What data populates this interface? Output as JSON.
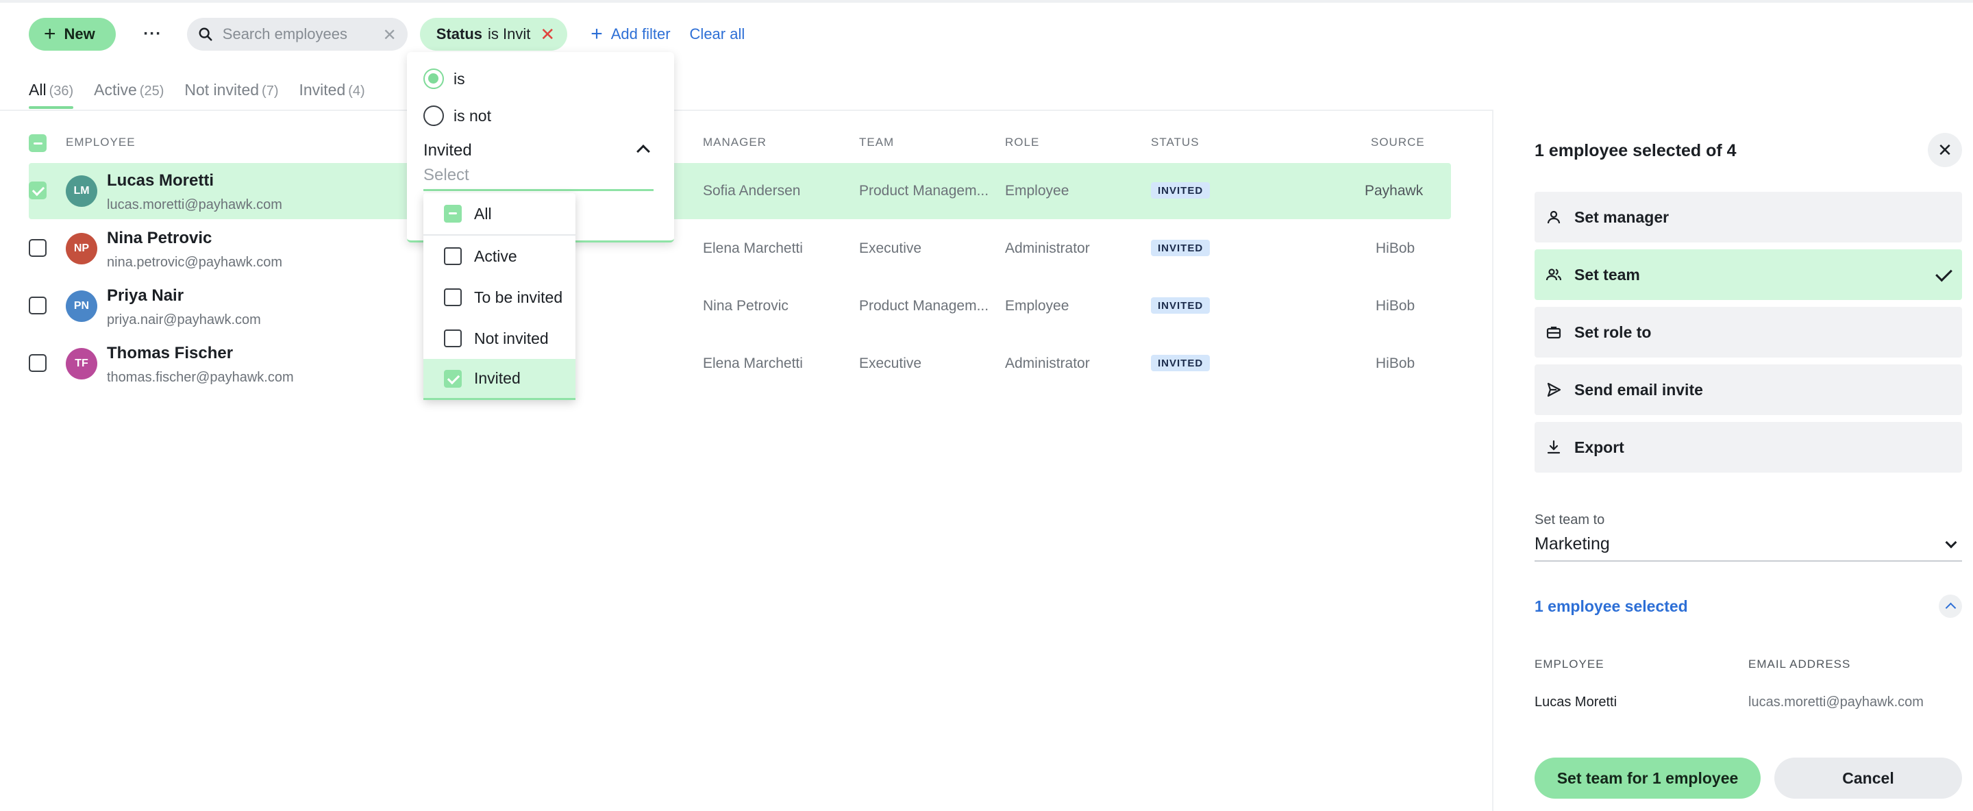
{
  "toolbar": {
    "new_label": "New",
    "search_placeholder": "Search employees",
    "filter_chip": {
      "field": "Status",
      "text": "is Invit"
    },
    "add_filter_label": "Add filter",
    "clear_all_label": "Clear all"
  },
  "tabs": [
    {
      "label": "All",
      "count": "(36)",
      "active": true
    },
    {
      "label": "Active",
      "count": "(25)"
    },
    {
      "label": "Not invited",
      "count": "(7)"
    },
    {
      "label": "Invited",
      "count": "(4)"
    }
  ],
  "table": {
    "headers": {
      "employee": "EMPLOYEE",
      "manager": "MANAGER",
      "team": "TEAM",
      "role": "ROLE",
      "status": "STATUS",
      "source": "SOURCE"
    },
    "rows": [
      {
        "initials": "LM",
        "avatar_color": "#4f9a8f",
        "name": "Lucas Moretti",
        "email": "lucas.moretti@payhawk.com",
        "manager": "Sofia Andersen",
        "team": "Product Managem...",
        "role": "Employee",
        "status": "INVITED",
        "source": "Payhawk",
        "selected": true
      },
      {
        "initials": "NP",
        "avatar_color": "#c4503d",
        "name": "Nina Petrovic",
        "email": "nina.petrovic@payhawk.com",
        "manager": "Elena Marchetti",
        "team": "Executive",
        "role": "Administrator",
        "status": "INVITED",
        "source": "HiBob",
        "selected": false
      },
      {
        "initials": "PN",
        "avatar_color": "#4a86c8",
        "name": "Priya Nair",
        "email": "priya.nair@payhawk.com",
        "manager": "Nina Petrovic",
        "team": "Product Managem...",
        "role": "Employee",
        "status": "INVITED",
        "source": "HiBob",
        "selected": false
      },
      {
        "initials": "TF",
        "avatar_color": "#b94a9a",
        "name": "Thomas Fischer",
        "email": "thomas.fischer@payhawk.com",
        "manager": "Elena Marchetti",
        "team": "Executive",
        "role": "Administrator",
        "status": "INVITED",
        "source": "HiBob",
        "selected": false
      }
    ]
  },
  "filter_popover": {
    "op_is": "is",
    "op_is_not": "is not",
    "selected_op": "is",
    "value": "Invited",
    "search_placeholder": "Select",
    "options": [
      {
        "label": "All",
        "state": "indeterminate"
      },
      {
        "label": "Active",
        "state": "unchecked"
      },
      {
        "label": "To be invited",
        "state": "unchecked"
      },
      {
        "label": "Not invited",
        "state": "unchecked"
      },
      {
        "label": "Invited",
        "state": "checked"
      }
    ]
  },
  "panel": {
    "title": "1 employee selected of 4",
    "actions": [
      {
        "label": "Set manager",
        "icon": "person-icon"
      },
      {
        "label": "Set team",
        "icon": "people-icon",
        "active": true
      },
      {
        "label": "Set role to",
        "icon": "briefcase-icon"
      },
      {
        "label": "Send email invite",
        "icon": "send-icon"
      },
      {
        "label": "Export",
        "icon": "download-icon"
      }
    ],
    "set_team_label": "Set team to",
    "set_team_value": "Marketing",
    "selected_summary": "1 employee selected",
    "mini_table": {
      "headers": {
        "employee": "EMPLOYEE",
        "email": "EMAIL ADDRESS"
      },
      "rows": [
        {
          "employee": "Lucas Moretti",
          "email": "lucas.moretti@payhawk.com"
        }
      ]
    },
    "primary_button": "Set team for 1 employee",
    "cancel_button": "Cancel"
  },
  "colors": {
    "accent": "#8fe3a6",
    "accent_light": "#d2f7dd",
    "link": "#2d6fd6",
    "badge": "#d4e6fb",
    "danger": "#e0443e"
  }
}
